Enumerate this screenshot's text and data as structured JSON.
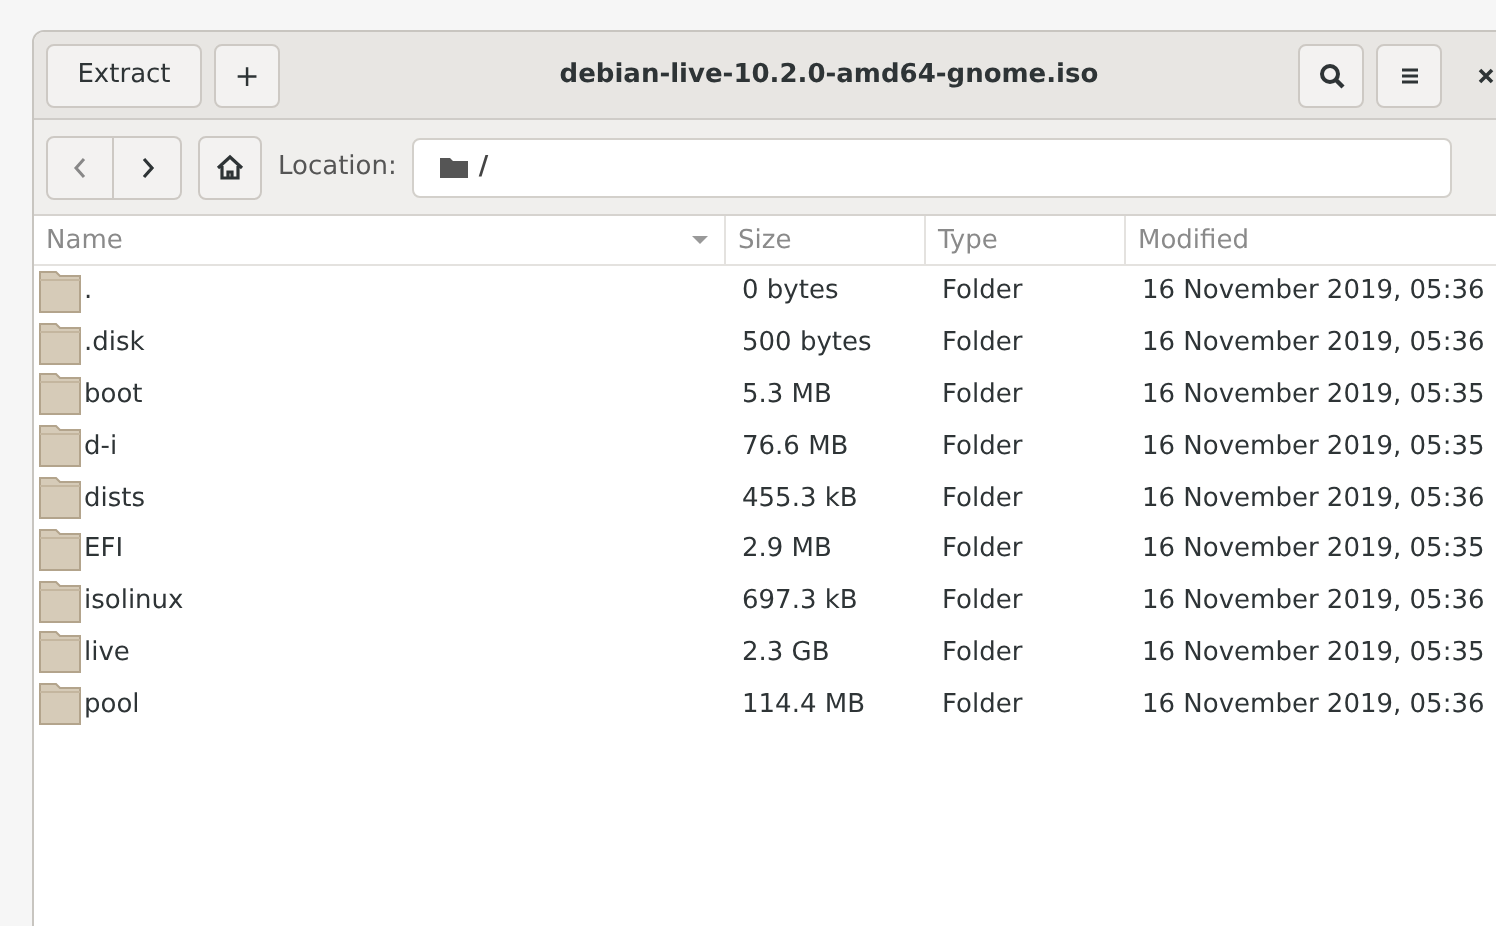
{
  "header_bar": {
    "buttons": [
      {
        "label": "Extract"
      },
      {
        "label": "+"
      }
    ],
    "title": "debian-live-10.2.0-amd64-gnome.iso"
  },
  "location_bar": {
    "label": "Location:",
    "path": "/"
  },
  "table": {
    "columns": [
      {
        "label": "Name",
        "sorted": true
      },
      {
        "label": "Size",
        "sorted": false
      },
      {
        "label": "Type",
        "sorted": false
      },
      {
        "label": "Modified",
        "sorted": false
      }
    ],
    "rows": [
      {
        "name": ".",
        "size": "0 bytes",
        "type": "Folder",
        "modified": "16 November 2019, 05:36"
      },
      {
        "name": ".disk",
        "size": "500 bytes",
        "type": "Folder",
        "modified": "16 November 2019, 05:36"
      },
      {
        "name": "boot",
        "size": "5.3 MB",
        "type": "Folder",
        "modified": "16 November 2019, 05:35"
      },
      {
        "name": "d-i",
        "size": "76.6 MB",
        "type": "Folder",
        "modified": "16 November 2019, 05:35"
      },
      {
        "name": "dists",
        "size": "455.3 kB",
        "type": "Folder",
        "modified": "16 November 2019, 05:36"
      },
      {
        "name": "EFI",
        "size": "2.9 MB",
        "type": "Folder",
        "modified": "16 November 2019, 05:35"
      },
      {
        "name": "isolinux",
        "size": "697.3 kB",
        "type": "Folder",
        "modified": "16 November 2019, 05:36"
      },
      {
        "name": "live",
        "size": "2.3 GB",
        "type": "Folder",
        "modified": "16 November 2019, 05:35"
      },
      {
        "name": "pool",
        "size": "114.4 MB",
        "type": "Folder",
        "modified": "16 November 2019, 05:36"
      }
    ]
  }
}
